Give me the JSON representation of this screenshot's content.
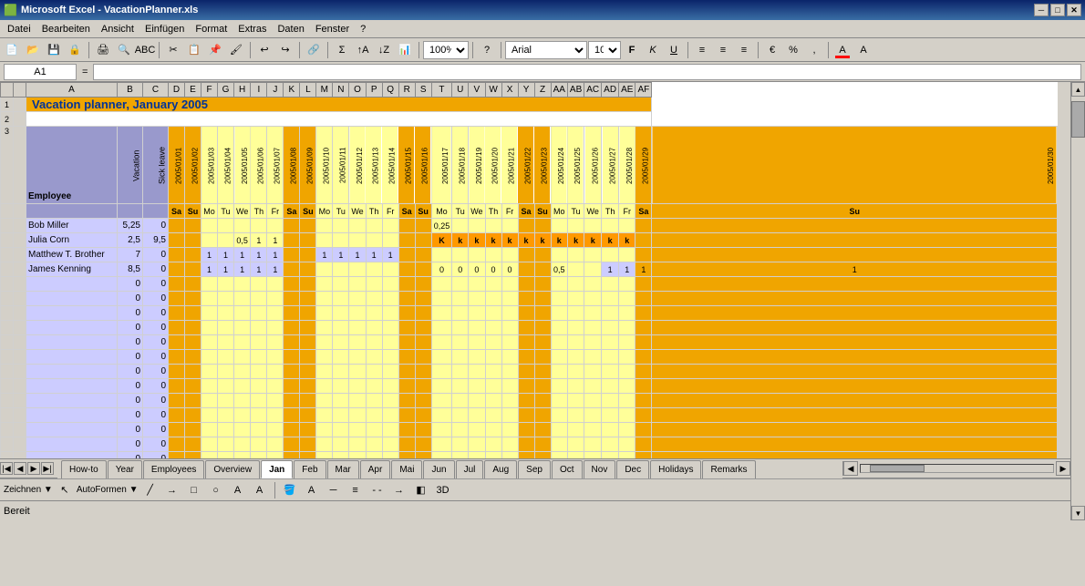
{
  "window": {
    "title": "Microsoft Excel - VacationPlanner.xls"
  },
  "menu": {
    "items": [
      "Datei",
      "Bearbeiten",
      "Ansicht",
      "Einfügen",
      "Format",
      "Extras",
      "Daten",
      "Fenster",
      "?"
    ]
  },
  "formula_bar": {
    "cell_ref": "A1",
    "eq": "=",
    "value": ""
  },
  "sheet": {
    "title": "Vacation planner, January 2005",
    "headers": {
      "employee": "Employee",
      "vacation": "Vacation",
      "sick_leave": "Sick leave"
    },
    "dates": [
      {
        "date": "2005/01/01",
        "day": "Sa",
        "orange": true
      },
      {
        "date": "2005/01/02",
        "day": "Su",
        "orange": true
      },
      {
        "date": "2005/01/03",
        "day": "Mo",
        "yellow": false
      },
      {
        "date": "2005/01/04",
        "day": "Tu",
        "yellow": false
      },
      {
        "date": "2005/01/05",
        "day": "We",
        "yellow": false
      },
      {
        "date": "2005/01/06",
        "day": "Th",
        "yellow": false
      },
      {
        "date": "2005/01/07",
        "day": "Fr",
        "yellow": false
      },
      {
        "date": "2005/01/08",
        "day": "Sa",
        "orange": true
      },
      {
        "date": "2005/01/09",
        "day": "Su",
        "orange": true
      },
      {
        "date": "2005/01/10",
        "day": "Mo",
        "yellow": false
      },
      {
        "date": "2005/01/11",
        "day": "Tu",
        "yellow": false
      },
      {
        "date": "2005/01/12",
        "day": "We",
        "yellow": false
      },
      {
        "date": "2005/01/13",
        "day": "Th",
        "yellow": false
      },
      {
        "date": "2005/01/14",
        "day": "Fr",
        "yellow": false
      },
      {
        "date": "2005/01/15",
        "day": "Sa",
        "orange": true
      },
      {
        "date": "2005/01/16",
        "day": "Su",
        "orange": true
      },
      {
        "date": "2005/01/17",
        "day": "Mo",
        "yellow": false
      },
      {
        "date": "2005/01/18",
        "day": "Tu",
        "yellow": false
      },
      {
        "date": "2005/01/19",
        "day": "We",
        "yellow": false
      },
      {
        "date": "2005/01/20",
        "day": "Th",
        "yellow": false
      },
      {
        "date": "2005/01/21",
        "day": "Fr",
        "yellow": false
      },
      {
        "date": "2005/01/22",
        "day": "Sa",
        "orange": true
      },
      {
        "date": "2005/01/23",
        "day": "Su",
        "orange": true
      },
      {
        "date": "2005/01/24",
        "day": "Mo",
        "yellow": false
      },
      {
        "date": "2005/01/25",
        "day": "Tu",
        "yellow": false
      },
      {
        "date": "2005/01/26",
        "day": "We",
        "yellow": false
      },
      {
        "date": "2005/01/27",
        "day": "Th",
        "yellow": false
      },
      {
        "date": "2005/01/28",
        "day": "Fr",
        "yellow": false
      },
      {
        "date": "2005/01/29",
        "day": "Sa",
        "orange": true
      },
      {
        "date": "2005/01/30",
        "day": "Su",
        "orange": true
      }
    ],
    "employees": [
      {
        "name": "Bob Miller",
        "vacation": "5,25",
        "sick": "0",
        "days": [
          "",
          "",
          "",
          "",
          "",
          "",
          "",
          "",
          "",
          "",
          "",
          "",
          "",
          "",
          "",
          "",
          "0,25",
          "",
          "",
          "",
          "",
          "",
          "",
          "",
          "",
          "",
          "",
          "",
          "",
          ""
        ]
      },
      {
        "name": "Julia Corn",
        "vacation": "2,5",
        "sick": "9,5",
        "days": [
          "",
          "",
          "",
          "",
          "0,5",
          "1",
          "1",
          "",
          "",
          "",
          "",
          "",
          "",
          "",
          "",
          "",
          "K",
          "k",
          "k",
          "k",
          "k",
          "k",
          "k",
          "k",
          "k",
          "k",
          "k",
          "k",
          "",
          ""
        ]
      },
      {
        "name": "Matthew T. Brother",
        "vacation": "7",
        "sick": "0",
        "days": [
          "",
          "",
          "1",
          "1",
          "1",
          "1",
          "1",
          "",
          "",
          "1",
          "1",
          "1",
          "1",
          "1",
          "",
          "",
          "",
          "",
          "",
          "",
          "",
          "",
          "",
          "",
          "",
          "",
          "",
          "",
          "",
          ""
        ]
      },
      {
        "name": "James Kenning",
        "vacation": "8,5",
        "sick": "0",
        "days": [
          "",
          "",
          "1",
          "1",
          "1",
          "1",
          "1",
          "",
          "",
          "",
          "",
          "",
          "",
          "",
          "",
          "",
          "0",
          "0",
          "0",
          "0",
          "0",
          "",
          "",
          "0,5",
          "",
          "",
          "1",
          "1",
          "1",
          "1"
        ]
      }
    ],
    "empty_rows": 16
  },
  "tabs": {
    "items": [
      "How-to",
      "Year",
      "Employees",
      "Overview",
      "Jan",
      "Feb",
      "Mar",
      "Apr",
      "Mai",
      "Jun",
      "Jul",
      "Aug",
      "Sep",
      "Oct",
      "Nov",
      "Dec",
      "Holidays",
      "Remarks"
    ],
    "active": "Jan"
  },
  "status": "Bereit",
  "toolbar": {
    "zoom": "100%",
    "font": "Arial",
    "font_size": "10"
  }
}
